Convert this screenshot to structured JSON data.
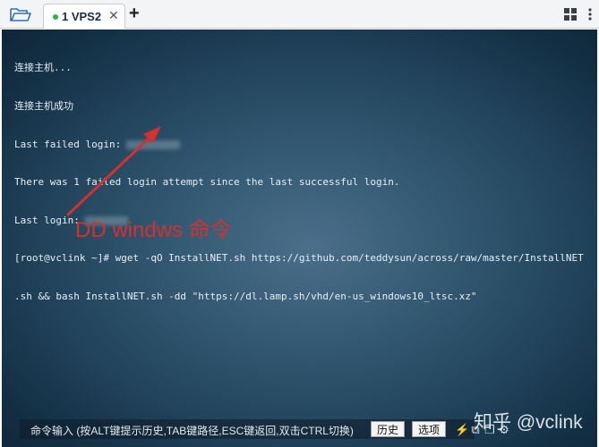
{
  "tabbar": {
    "folder_icon": "folder-open-icon",
    "tabs": [
      {
        "label": "1 VPS2",
        "status_color": "#2bb24c",
        "close": "✕"
      }
    ],
    "add_label": "+",
    "layout_icon": "grid-layout-icon",
    "menu_icon": "vertical-menu-icon"
  },
  "terminal": {
    "lines": [
      "连接主机...",
      "连接主机成功",
      "Last failed login:",
      "There was 1 failed login attempt since the last successful login.",
      "Last login:",
      "[root@vclink ~]# wget -qO InstallNET.sh https://github.com/teddysun/across/raw/master/InstallNET",
      ".sh && bash InstallNET.sh -dd \"https://dl.lamp.sh/vhd/en-us_windows10_ltsc.xz\""
    ],
    "annotation": "DD windws 命令",
    "annotation_color": "#d5302e"
  },
  "command_bar": {
    "hint": "命令输入 (按ALT键提示历史,TAB键路径,ESC键返回,双击CTRL切换)",
    "history_button": "历史",
    "options_button": "选项"
  },
  "tools": [
    "lightning-icon",
    "copy-icon",
    "paste-icon",
    "settings-icon"
  ],
  "watermark": "知乎 @vclink"
}
